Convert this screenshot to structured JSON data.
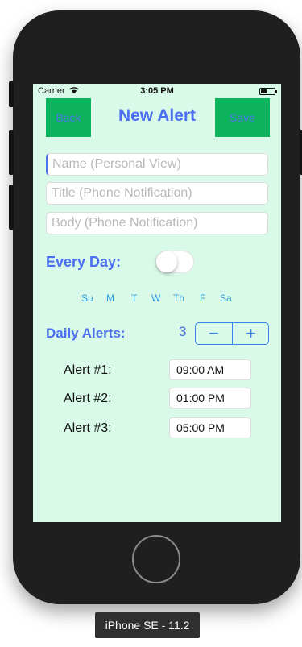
{
  "status_bar": {
    "carrier": "Carrier",
    "time": "3:05 PM"
  },
  "nav": {
    "back_label": "Back",
    "title": "New Alert",
    "save_label": "Save"
  },
  "form": {
    "name_placeholder": "Name (Personal View)",
    "title_placeholder": "Title (Phone Notification)",
    "body_placeholder": "Body (Phone Notification)"
  },
  "every_day": {
    "label": "Every Day:",
    "enabled": false
  },
  "days": [
    "Su",
    "M",
    "T",
    "W",
    "Th",
    "F",
    "Sa"
  ],
  "daily_alerts": {
    "label": "Daily Alerts:",
    "count": "3",
    "minus": "−",
    "plus": "+"
  },
  "alerts": [
    {
      "label": "Alert #1:",
      "time": "09:00 AM"
    },
    {
      "label": "Alert #2:",
      "time": "01:00 PM"
    },
    {
      "label": "Alert #3:",
      "time": "05:00 PM"
    }
  ],
  "simulator": {
    "device_label": "iPhone SE - 11.2"
  },
  "colors": {
    "screen_bg": "#d9fae9",
    "button_green": "#0fb35e",
    "accent_blue": "#4b74e6",
    "day_blue": "#2f9ee0"
  }
}
